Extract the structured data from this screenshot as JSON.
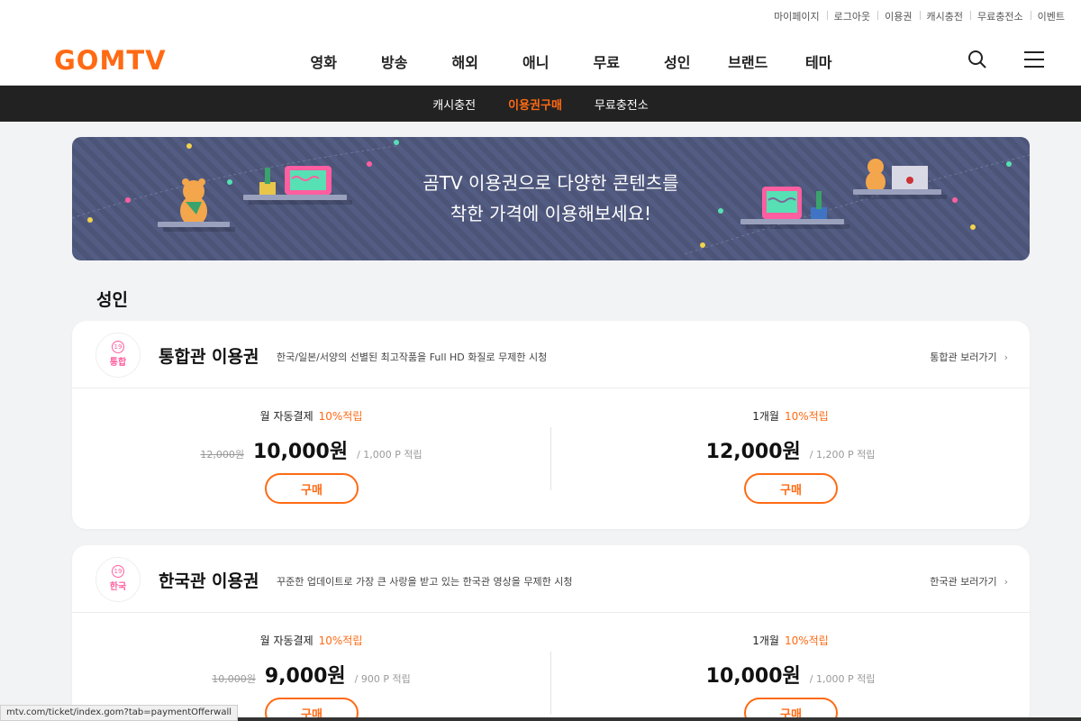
{
  "util_links": [
    "마이페이지",
    "로그아웃",
    "이용권",
    "캐시충전",
    "무료충전소",
    "이벤트"
  ],
  "logo": "GOMTV",
  "gnb": [
    "영화",
    "방송",
    "해외",
    "애니",
    "무료",
    "성인",
    "브랜드",
    "테마"
  ],
  "subnav": [
    {
      "label": "캐시충전",
      "active": false
    },
    {
      "label": "이용권구매",
      "active": true
    },
    {
      "label": "무료충전소",
      "active": false
    }
  ],
  "banner": {
    "line1": "곰TV 이용권으로 다양한 콘텐츠를",
    "line2": "착한 가격에 이용해보세요!"
  },
  "section_title": "성인",
  "products": [
    {
      "badge_num": "19",
      "badge_text": "통합",
      "title": "통합관 이용권",
      "desc": "한국/일본/서양의 선별된 최고작품을 Full HD 화질로 무제한 시청",
      "link": "통합관 보러가기",
      "plans": [
        {
          "name": "월 자동결제",
          "points": "10%적립",
          "old_price": "12,000원",
          "price": "10,000원",
          "reward": "/ 1,000 P 적립",
          "buy": "구매"
        },
        {
          "name": "1개월",
          "points": "10%적립",
          "old_price": "",
          "price": "12,000원",
          "reward": "/ 1,200 P 적립",
          "buy": "구매"
        }
      ]
    },
    {
      "badge_num": "19",
      "badge_text": "한국",
      "title": "한국관 이용권",
      "desc": "꾸준한 업데이트로 가장 큰 사랑을 받고 있는 한국관 영상을 무제한 시청",
      "link": "한국관 보러가기",
      "plans": [
        {
          "name": "월 자동결제",
          "points": "10%적립",
          "old_price": "10,000원",
          "price": "9,000원",
          "reward": "/ 900 P 적립",
          "buy": "구매"
        },
        {
          "name": "1개월",
          "points": "10%적립",
          "old_price": "",
          "price": "10,000원",
          "reward": "/ 1,000 P 적립",
          "buy": "구매"
        }
      ]
    }
  ],
  "status_url": "mtv.com/ticket/index.gom?tab=paymentOfferwall",
  "colors": {
    "accent": "#ff6a13",
    "banner": "#4f5780",
    "subnav_bg": "#222222"
  }
}
